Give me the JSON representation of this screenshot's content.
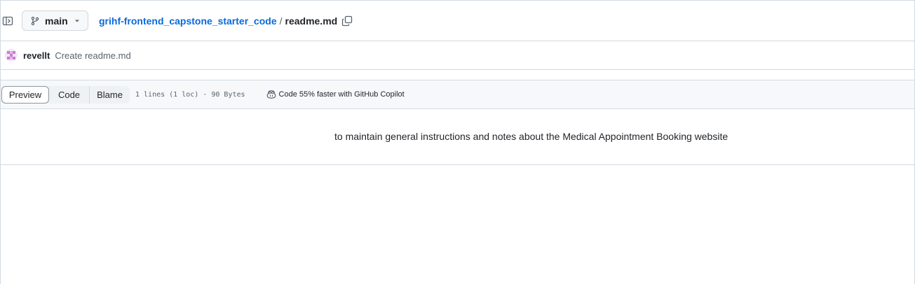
{
  "header": {
    "branch": "main",
    "repo": "grihf-frontend_capstone_starter_code",
    "separator": "/",
    "file": "readme.md"
  },
  "commit": {
    "author": "revellt",
    "message": "Create readme.md"
  },
  "file_header": {
    "tabs": [
      "Preview",
      "Code",
      "Blame"
    ],
    "active_tab": "Preview",
    "meta": "1 lines (1 loc) · 90 Bytes",
    "copilot": "Code 55% faster with GitHub Copilot"
  },
  "content": {
    "text": "to maintain general instructions and notes about the Medical Appointment Booking website"
  },
  "icons": {
    "sidebar": "sidebar-expand-icon",
    "branch": "git-branch-icon",
    "caret": "triangle-down-icon",
    "copy": "copy-icon",
    "copilot": "copilot-icon"
  },
  "colors": {
    "link": "#0969da",
    "border": "#d1d9e0",
    "muted": "#59636e",
    "header_bg": "#f6f8fa"
  }
}
